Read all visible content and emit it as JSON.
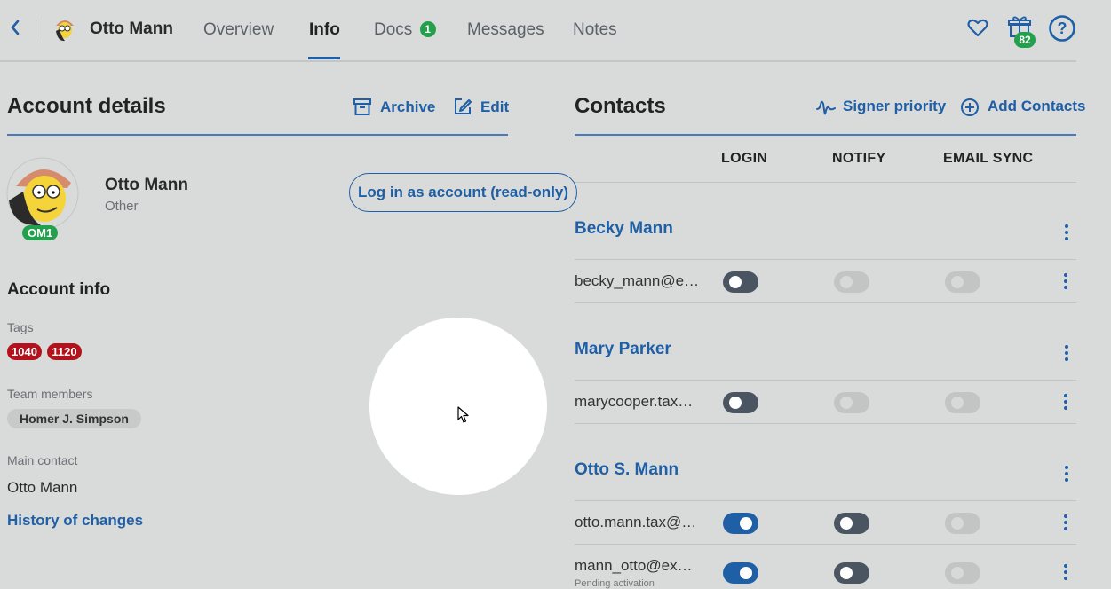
{
  "header": {
    "back_icon": "chevron-left-icon",
    "user_name": "Otto Mann",
    "tabs": [
      {
        "label": "Overview"
      },
      {
        "label": "Info",
        "active": true
      },
      {
        "label": "Docs",
        "badge": "1"
      },
      {
        "label": "Messages"
      },
      {
        "label": "Notes"
      }
    ],
    "gift_badge": "82",
    "icons": [
      "heart-icon",
      "gift-icon",
      "help-icon"
    ]
  },
  "account": {
    "section_title": "Account details",
    "archive_label": "Archive",
    "edit_label": "Edit",
    "name": "Otto Mann",
    "type": "Other",
    "id_badge": "OM1",
    "login_button": "Log in as account (read-only)",
    "info_title": "Account info",
    "tags_label": "Tags",
    "tags": [
      "1040",
      "1120"
    ],
    "team_label": "Team members",
    "team_members": [
      "Homer J. Simpson"
    ],
    "main_contact_label": "Main contact",
    "main_contact": "Otto Mann",
    "history_link": "History of changes"
  },
  "contacts": {
    "section_title": "Contacts",
    "signer_priority_label": "Signer priority",
    "add_contacts_label": "Add Contacts",
    "columns": [
      "LOGIN",
      "NOTIFY",
      "EMAIL SYNC"
    ],
    "people": [
      {
        "name": "Becky Mann",
        "emails": [
          {
            "email": "becky_mann@e…",
            "login": false,
            "notify": "disabled",
            "sync": "disabled"
          }
        ]
      },
      {
        "name": "Mary Parker",
        "emails": [
          {
            "email": "marycooper.tax…",
            "login": false,
            "notify": "disabled",
            "sync": "disabled"
          }
        ]
      },
      {
        "name": "Otto S. Mann",
        "emails": [
          {
            "email": "otto.mann.tax@…",
            "login": true,
            "notify": false,
            "sync": "disabled"
          },
          {
            "email": "mann_otto@ex…",
            "login": true,
            "notify": false,
            "sync": "disabled",
            "note": "Pending activation"
          }
        ]
      }
    ]
  },
  "colors": {
    "accent": "#1f5fa6",
    "tag_red": "#b3121c",
    "badge_green": "#23a04b",
    "background": "#d9dbda"
  }
}
